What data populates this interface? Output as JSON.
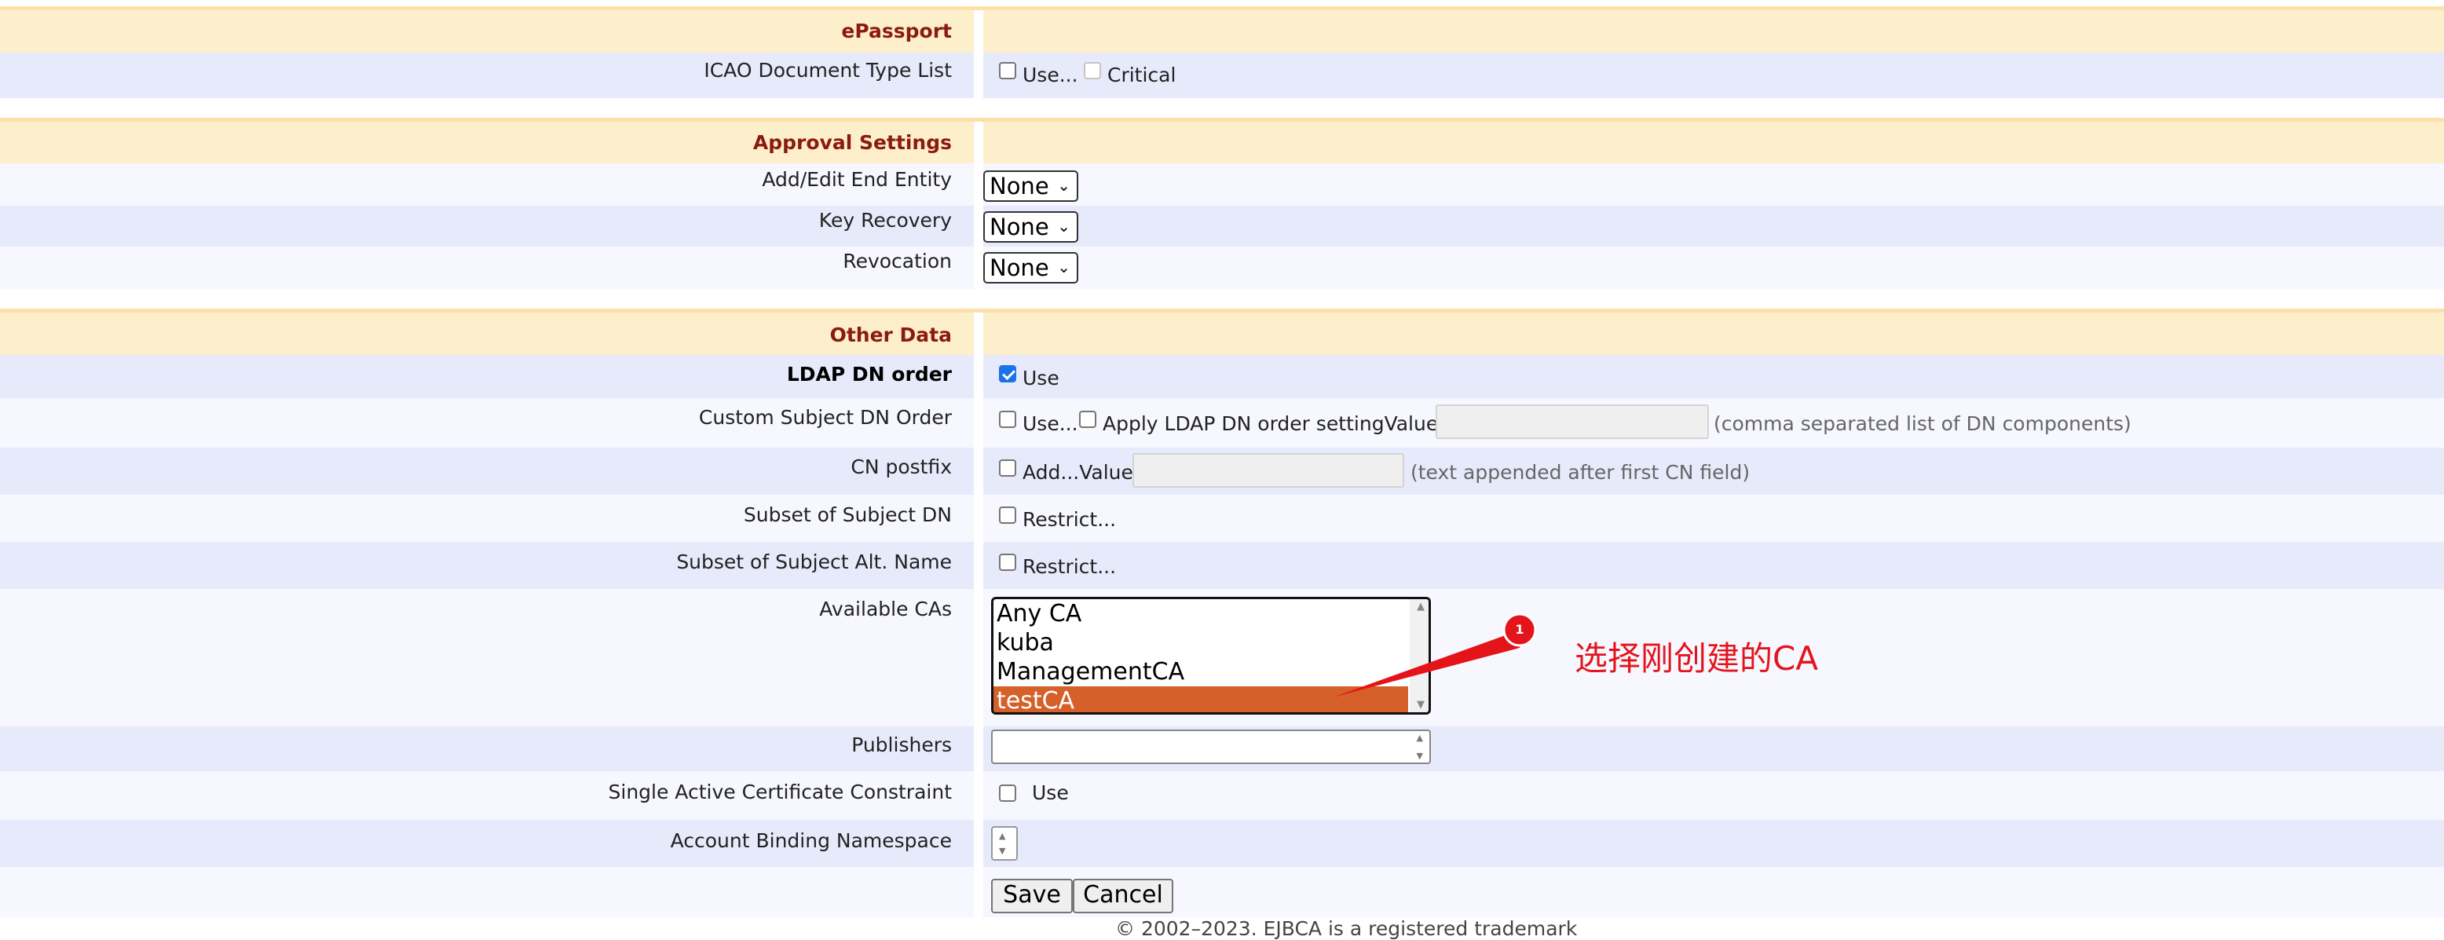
{
  "sections": {
    "epassport": "ePassport",
    "approval": "Approval Settings",
    "other": "Other Data"
  },
  "icao": {
    "label": "ICAO Document Type List",
    "use_label": "Use...",
    "critical_label": "Critical"
  },
  "approval": {
    "add_edit": {
      "label": "Add/Edit End Entity",
      "value": "None"
    },
    "key_recovery": {
      "label": "Key Recovery",
      "value": "None"
    },
    "revocation": {
      "label": "Revocation",
      "value": "None"
    }
  },
  "ldap_dn_order": {
    "label": "LDAP DN order",
    "use_label": "Use",
    "checked": true
  },
  "custom_subject_dn": {
    "label": "Custom Subject DN Order",
    "use_label": "Use...",
    "apply_label": "Apply LDAP DN order settingValue",
    "value": "",
    "hint": "(comma separated list of DN components)"
  },
  "cn_postfix": {
    "label": "CN postfix",
    "add_label": "Add...Value",
    "value": "",
    "hint": "(text appended after first CN field)"
  },
  "subset_subject_dn": {
    "label": "Subset of Subject DN",
    "restrict_label": "Restrict..."
  },
  "subset_alt_name": {
    "label": "Subset of Subject Alt. Name",
    "restrict_label": "Restrict..."
  },
  "available_cas": {
    "label": "Available CAs",
    "options": [
      "Any CA",
      "kuba",
      "ManagementCA",
      "testCA"
    ],
    "selected": "testCA"
  },
  "annotation": {
    "badge": "1",
    "text": "选择刚创建的CA",
    "color": "#e5141b"
  },
  "publishers": {
    "label": "Publishers"
  },
  "single_active": {
    "label": "Single Active Certificate Constraint",
    "use_label": "Use"
  },
  "account_binding": {
    "label": "Account Binding Namespace"
  },
  "buttons": {
    "save": "Save",
    "cancel": "Cancel"
  },
  "footer": "© 2002–2023. EJBCA is a registered trademark"
}
